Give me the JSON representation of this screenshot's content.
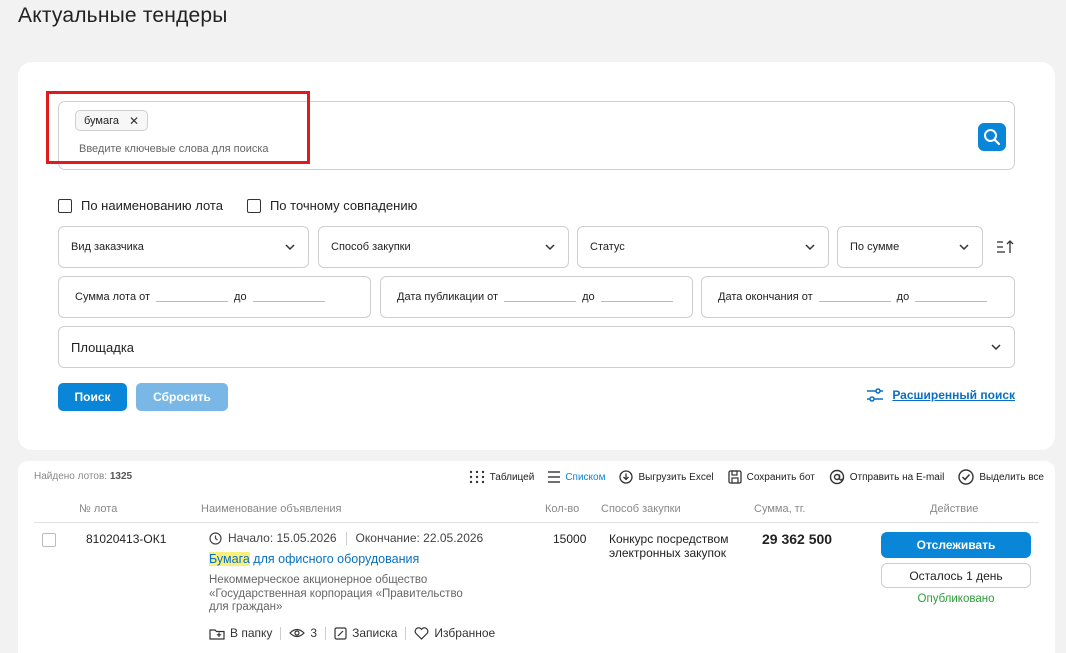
{
  "page_title": "Актуальные тендеры",
  "search": {
    "chip_label": "бумага",
    "chip_close": "✕",
    "placeholder": "Введите ключевые слова для поиска"
  },
  "checkboxes": {
    "by_lot_name": "По наименованию лота",
    "exact_match": "По точному совпадению"
  },
  "filters": {
    "customer_type": "Вид заказчика",
    "procurement_method": "Способ закупки",
    "status": "Статус",
    "sort": "По сумме",
    "lot_sum_from": "Сумма лота от",
    "to": "до",
    "pub_date_from": "Дата публикации от",
    "end_date_from": "Дата окончания от",
    "platform": "Площадка"
  },
  "buttons": {
    "search": "Поиск",
    "reset": "Сбросить",
    "advanced": "Расширенный поиск"
  },
  "results": {
    "found_label": "Найдено лотов:",
    "found_count": "1325",
    "tools": {
      "table": "Таблицей",
      "list": "Списком",
      "excel": "Выгрузить Excel",
      "save_bot": "Сохранить бот",
      "email": "Отправить на E-mail",
      "select_all": "Выделить все"
    },
    "columns": {
      "lot_no": "№ лота",
      "name": "Наименование объявления",
      "qty": "Кол-во",
      "method": "Способ закупки",
      "sum": "Сумма, тг.",
      "action": "Действие"
    },
    "rows": [
      {
        "lot_no": "81020413-ОК1",
        "start": "Начало: 15.05.2026",
        "end": "Окончание: 22.05.2026",
        "title_highlight": "Бумага",
        "title_rest": " для офисного оборудования",
        "org": "Некоммерческое акционерное общество «Государственная корпорация «Правительство для граждан»",
        "qty": "15000",
        "method": "Конкурс посредством электронных закупок",
        "sum": "29 362 500",
        "track": "Отслеживать",
        "remaining": "Осталось 1 день",
        "status": "Опубликовано",
        "folder": "В папку",
        "views": "3",
        "note": "Записка",
        "favorite": "Избранное"
      }
    ]
  },
  "colors": {
    "accent": "#0a86d8",
    "link": "#0a6fc2",
    "published": "#2d9d3a",
    "highlight_frame": "#e01b1b"
  }
}
